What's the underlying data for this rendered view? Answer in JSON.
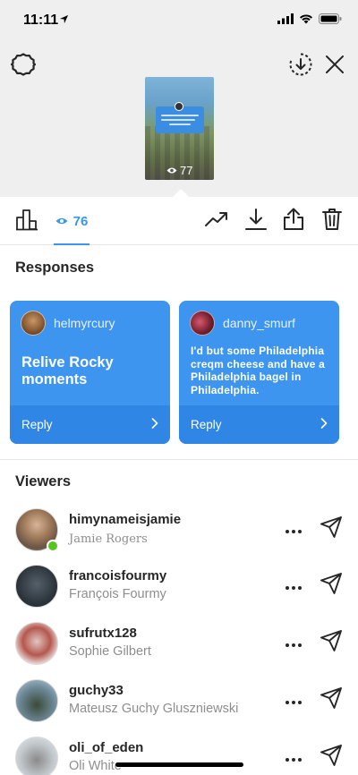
{
  "status_bar": {
    "time": "11:11"
  },
  "story_preview": {
    "view_count": "77"
  },
  "toolbar": {
    "viewers_count": "76"
  },
  "responses": {
    "title": "Responses",
    "cards": [
      {
        "username": "helmyrcury",
        "text": "Relive Rocky moments",
        "reply_label": "Reply"
      },
      {
        "username": "danny_smurf",
        "text": "I'd but some Philadelphia creqm cheese and have a Philadelphia bagel in Philadelphia.",
        "reply_label": "Reply"
      }
    ]
  },
  "viewers": {
    "title": "Viewers",
    "items": [
      {
        "username": "himynameisjamie",
        "name": "Jamie Rogers",
        "online": true
      },
      {
        "username": "francoisfourmy",
        "name": "François Fourmy",
        "online": false
      },
      {
        "username": "sufrutx128",
        "name": "Sophie Gilbert",
        "online": false
      },
      {
        "username": "guchy33",
        "name": "Mateusz Guchy Gluszniewski",
        "online": false
      },
      {
        "username": "oli_of_eden",
        "name": "Oli White",
        "online": false
      }
    ]
  },
  "colors": {
    "accent": "#3897f0",
    "card": "#3d95ef",
    "online": "#58c322"
  },
  "icons": [
    "settings-icon",
    "download-circle-icon",
    "close-icon",
    "bar-chart-icon",
    "eye-icon",
    "trending-icon",
    "download-icon",
    "share-icon",
    "trash-icon",
    "chevron-right-icon",
    "more-icon",
    "send-icon"
  ]
}
